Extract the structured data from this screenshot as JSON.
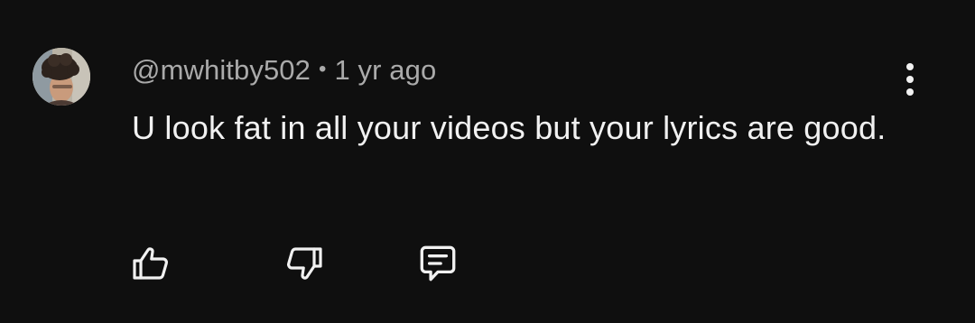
{
  "comment": {
    "username": "@mwhitby502",
    "separator": "•",
    "timestamp": "1 yr ago",
    "text": "U look fat in all your videos but your lyrics are good."
  },
  "icons": {
    "avatar": "user-avatar",
    "more": "more-vertical-icon",
    "like": "thumbs-up-icon",
    "dislike": "thumbs-down-icon",
    "reply": "comment-reply-icon"
  },
  "colors": {
    "background": "#0f0f0f",
    "primary_text": "#f1f1f1",
    "secondary_text": "#aaaaaa"
  }
}
